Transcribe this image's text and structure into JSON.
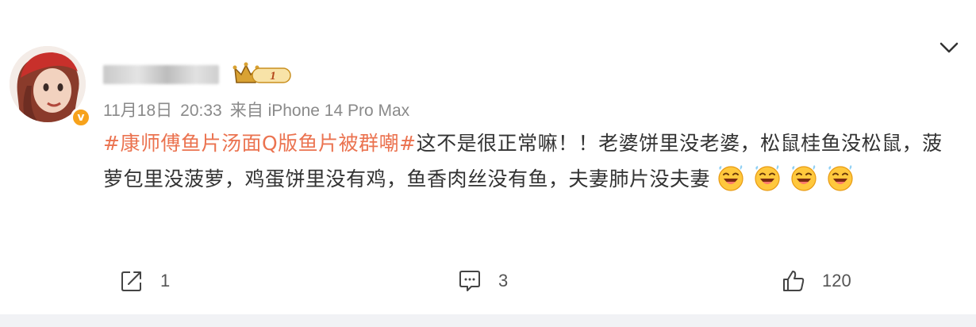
{
  "post": {
    "username": "",
    "meta": {
      "date": "11月18日",
      "time": "20:33",
      "source": "来自 iPhone 14 Pro Max"
    },
    "hashtag": "#康师傅鱼片汤面Q版鱼片被群嘲#",
    "text": "这不是很正常嘛！！老婆饼里没老婆，松鼠桂鱼没松鼠，菠萝包里没菠萝，鸡蛋饼里没有鸡，鱼香肉丝没有鱼，夫妻肺片没夫妻",
    "emoji_count": 4,
    "emoji_name": "laughing-tears-emoji",
    "badge_level": "1",
    "verified_mark": "v"
  },
  "actions": {
    "share_count": "1",
    "comment_count": "3",
    "like_count": "120"
  },
  "colors": {
    "hashtag": "#eb7350",
    "meta": "#8a8a8a",
    "text": "#333333",
    "verified": "#f7a21b",
    "crown": "#d9a233"
  },
  "icons": [
    "avatar",
    "verified-icon",
    "crown-level-badge-icon",
    "chevron-down-icon",
    "share-icon",
    "comment-icon",
    "like-icon"
  ]
}
